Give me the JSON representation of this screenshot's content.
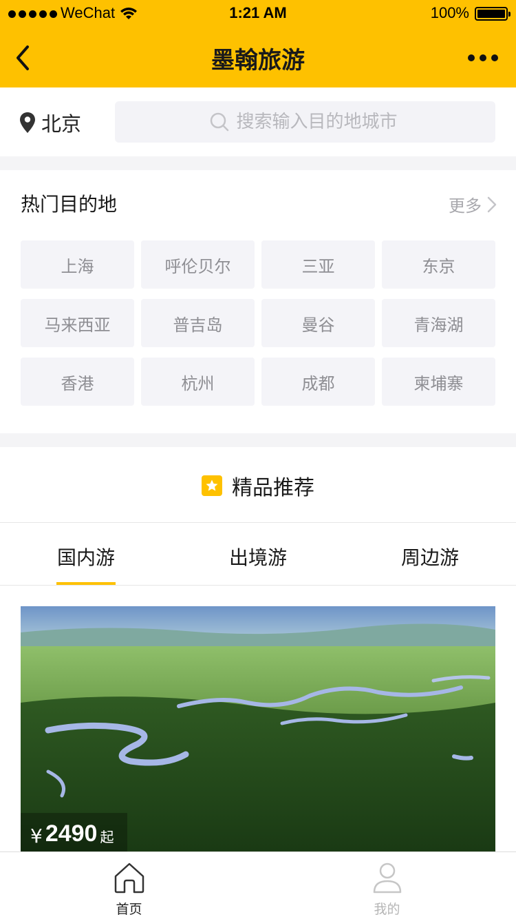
{
  "status_bar": {
    "carrier": "WeChat",
    "time": "1:21 AM",
    "battery": "100%"
  },
  "nav": {
    "title": "墨翰旅游"
  },
  "location": {
    "city": "北京"
  },
  "search": {
    "placeholder": "搜索输入目的地城市"
  },
  "hot": {
    "title": "热门目的地",
    "more": "更多",
    "destinations": [
      "上海",
      "呼伦贝尔",
      "三亚",
      "东京",
      "马来西亚",
      "普吉岛",
      "曼谷",
      "青海湖",
      "香港",
      "杭州",
      "成都",
      "柬埔寨"
    ]
  },
  "recommend": {
    "title": "精品推荐",
    "tabs": [
      "国内游",
      "出境游",
      "周边游"
    ],
    "active_tab": "国内游"
  },
  "card": {
    "currency": "¥",
    "price": "2490",
    "suffix": "起"
  },
  "tabbar": {
    "items": [
      {
        "label": "首页",
        "icon": "home-icon",
        "active": true
      },
      {
        "label": "我的",
        "icon": "user-icon",
        "active": false
      }
    ]
  },
  "colors": {
    "accent": "#fec100",
    "chip_bg": "#f4f4f8",
    "muted_text": "#8e8e93"
  }
}
